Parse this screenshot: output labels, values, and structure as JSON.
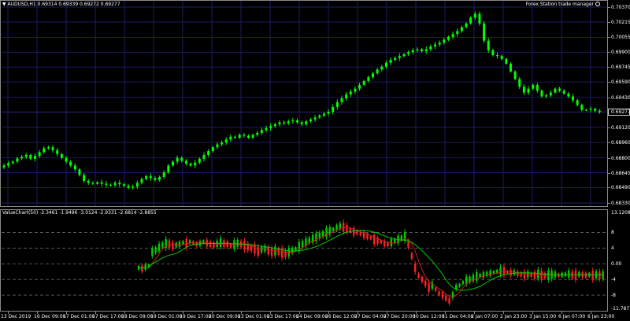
{
  "main_chart": {
    "title": "▼ AUDUSD,H1  0.69314 0.69339 0.69272 0.69277",
    "manager_label": "Forex Station trade manager",
    "current_price": "0.69277",
    "candle_color": "#00ff00",
    "grid_color": "#1b1b66",
    "price_line_color": "#2a2a7a",
    "price_axis": [
      "0.70370",
      "0.70215",
      "0.70055",
      "0.69900",
      "0.69745",
      "0.69590",
      "0.69430",
      "0.69277",
      "0.69120",
      "0.68960",
      "0.68800",
      "0.68645",
      "0.68490",
      "0.68330"
    ],
    "price_range": [
      0.6833,
      0.7037
    ],
    "closes": [
      0.6872,
      0.68745,
      0.6876,
      0.68795,
      0.6881,
      0.6883,
      0.6879,
      0.6882,
      0.6886,
      0.689,
      0.6891,
      0.6888,
      0.6884,
      0.688,
      0.6876,
      0.6872,
      0.6868,
      0.6862,
      0.6856,
      0.6854,
      0.6853,
      0.68545,
      0.6853,
      0.6852,
      0.68515,
      0.6854,
      0.68525,
      0.6851,
      0.6849,
      0.685,
      0.6854,
      0.6858,
      0.6861,
      0.6859,
      0.6857,
      0.686,
      0.6865,
      0.6872,
      0.6876,
      0.688,
      0.6877,
      0.6874,
      0.6872,
      0.6875,
      0.6879,
      0.6883,
      0.6887,
      0.6891,
      0.6894,
      0.6896,
      0.6899,
      0.6902,
      0.6901,
      0.6904,
      0.6903,
      0.6901,
      0.6904,
      0.6906,
      0.6909,
      0.6911,
      0.6913,
      0.6915,
      0.6917,
      0.6916,
      0.6918,
      0.6919,
      0.6917,
      0.6915,
      0.6918,
      0.692,
      0.6922,
      0.6924,
      0.6926,
      0.6928,
      0.6933,
      0.6938,
      0.6942,
      0.6946,
      0.6949,
      0.6952,
      0.6956,
      0.696,
      0.6964,
      0.6968,
      0.6972,
      0.6975,
      0.6979,
      0.6982,
      0.6984,
      0.6986,
      0.6988,
      0.699,
      0.6992,
      0.6993,
      0.6991,
      0.6993,
      0.6996,
      0.6998,
      0.7,
      0.7003,
      0.7006,
      0.7009,
      0.7012,
      0.7016,
      0.702,
      0.7026,
      0.703,
      0.702,
      0.7002,
      0.6992,
      0.6987,
      0.6986,
      0.6983,
      0.6978,
      0.697,
      0.6962,
      0.6954,
      0.6948,
      0.6952,
      0.6956,
      0.695,
      0.6944,
      0.6945,
      0.6948,
      0.6952,
      0.695,
      0.6947,
      0.6944,
      0.694,
      0.6935,
      0.693,
      0.693,
      0.6931,
      0.6929,
      0.69277
    ]
  },
  "indicator": {
    "title": "ValueChart(50) -2.3461 -1.9496 -3.0124 -2.9331 -2.6814 -2.8855",
    "axis": [
      "13.1208",
      "8",
      "4",
      "0.00",
      "-4",
      "-8",
      "-11.7877"
    ],
    "range": [
      -11.7877,
      13.1208
    ],
    "levels": [
      8,
      4,
      0,
      -4,
      -8
    ],
    "bull_color": "#00cc00",
    "bear_color": "#ff2020",
    "ma_fast_color": "#cc2020",
    "ma_slow_color": "#00cc00",
    "level_color": "#555555",
    "values": [
      -1.0,
      -1.2,
      -0.8,
      -0.5,
      3.0,
      3.5,
      4.2,
      4.8,
      5.2,
      5.0,
      4.6,
      4.8,
      5.0,
      5.4,
      5.2,
      5.6,
      5.4,
      5.0,
      5.2,
      5.6,
      5.3,
      5.0,
      4.8,
      5.1,
      5.4,
      5.2,
      5.0,
      4.6,
      4.9,
      5.2,
      5.0,
      4.7,
      4.3,
      4.0,
      3.8,
      3.2,
      3.6,
      3.9,
      3.4,
      3.0,
      3.3,
      3.1,
      2.8,
      2.6,
      3.0,
      3.4,
      3.8,
      4.4,
      5.0,
      5.6,
      6.0,
      6.4,
      6.8,
      7.2,
      7.6,
      8.0,
      8.4,
      8.8,
      9.2,
      9.6,
      9.4,
      9.0,
      8.6,
      8.2,
      8.0,
      7.8,
      7.4,
      7.0,
      6.6,
      6.2,
      5.9,
      5.6,
      5.2,
      5.0,
      5.4,
      5.8,
      6.2,
      6.6,
      7.0,
      5.0,
      2.0,
      -1.0,
      -3.0,
      -4.0,
      -5.0,
      -6.0,
      -5.5,
      -6.5,
      -7.5,
      -8.0,
      -8.8,
      -9.5,
      -8.0,
      -6.0,
      -5.5,
      -4.8,
      -4.2,
      -4.0,
      -3.6,
      -3.2,
      -3.0,
      -2.8,
      -2.6,
      -2.4,
      -2.2,
      -2.0,
      -1.8,
      -1.9,
      -2.1,
      -2.3,
      -2.2,
      -2.5,
      -2.7,
      -2.9,
      -2.7,
      -2.8,
      -2.9,
      -2.6,
      -2.9,
      -3.0,
      -2.9,
      -2.8,
      -2.7,
      -2.9,
      -2.8,
      -2.7,
      -2.6,
      -2.8,
      -2.9,
      -2.7,
      -2.8,
      -2.9,
      -2.8,
      -2.9,
      -2.8,
      -2.9,
      -2.9
    ]
  },
  "time_axis": [
    "13 Dec 2019",
    "16 Dec 09:00",
    "17 Dec 01:00",
    "17 Dec 17:00",
    "18 Dec 09:00",
    "19 Dec 01:00",
    "19 Dec 17:00",
    "20 Dec 09:00",
    "23 Dec 01:00",
    "23 Dec 17:00",
    "24 Dec 09:00",
    "26 Dec 12:00",
    "27 Dec 04:00",
    "27 Dec 20:00",
    "30 Dec 12:00",
    "31 Dec 04:00",
    "2 Jan 07:00",
    "2 Jan 23:00",
    "3 Jan 15:00",
    "6 Jan 07:00",
    "6 Jan 23:00"
  ]
}
